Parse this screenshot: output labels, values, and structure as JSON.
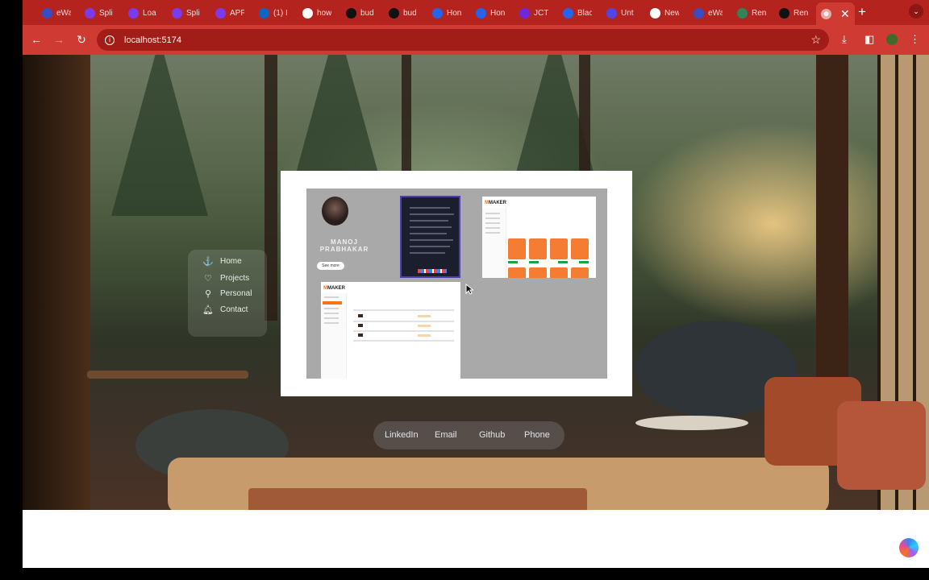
{
  "browser": {
    "tabs": [
      {
        "label": "eWa",
        "icon": "ewa-icon",
        "color": "#3b4cc0"
      },
      {
        "label": "Spli",
        "icon": "split-icon",
        "color": "#7c3aed"
      },
      {
        "label": "Loa",
        "icon": "loader-icon",
        "color": "#7c3aed"
      },
      {
        "label": "Spli",
        "icon": "split-icon",
        "color": "#7c3aed"
      },
      {
        "label": "APF",
        "icon": "apf-icon",
        "color": "#7c3aed"
      },
      {
        "label": "(1) I",
        "icon": "linkedin-icon",
        "color": "#0a66c2"
      },
      {
        "label": "how",
        "icon": "google-icon",
        "color": "#ffffff"
      },
      {
        "label": "bud",
        "icon": "github-icon",
        "color": "#111111"
      },
      {
        "label": "bud",
        "icon": "github-icon",
        "color": "#111111"
      },
      {
        "label": "Hon",
        "icon": "c-icon",
        "color": "#2563eb"
      },
      {
        "label": "Hon",
        "icon": "c-icon",
        "color": "#2563eb"
      },
      {
        "label": "JCT",
        "icon": "jct-icon",
        "color": "#6d28d9"
      },
      {
        "label": "Blac",
        "icon": "c-icon",
        "color": "#2563eb"
      },
      {
        "label": "Unt",
        "icon": "doc-icon",
        "color": "#4f46e5"
      },
      {
        "label": "New",
        "icon": "chrome-icon",
        "color": "#ffffff"
      },
      {
        "label": "eWa",
        "icon": "ewa-icon",
        "color": "#3b4cc0"
      },
      {
        "label": "Ren",
        "icon": "layers-icon",
        "color": "#2f855a"
      },
      {
        "label": "Ren",
        "icon": "a-icon",
        "color": "#111111"
      }
    ],
    "active_tab_close": "✕",
    "new_tab": "+",
    "url": "localhost:5174"
  },
  "sidenav": {
    "items": [
      {
        "label": "Home",
        "icon": "anchor-icon"
      },
      {
        "label": "Projects",
        "icon": "heart-icon"
      },
      {
        "label": "Personal",
        "icon": "person-icon"
      },
      {
        "label": "Contact",
        "icon": "bell-icon"
      }
    ]
  },
  "preview": {
    "name": "MANOJ PRABHAKAR",
    "see_more": "See more",
    "brand_left": "M",
    "brand_right": "MAKER"
  },
  "social": {
    "links": [
      "LinkedIn",
      "Email",
      "Github",
      "Phone"
    ]
  }
}
